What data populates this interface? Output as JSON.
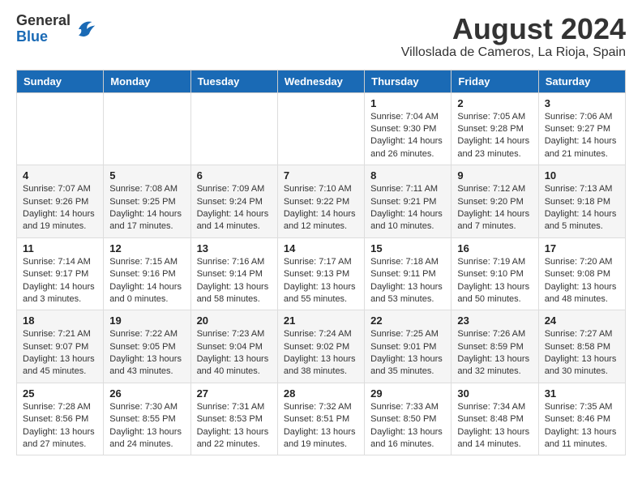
{
  "header": {
    "logo": {
      "general": "General",
      "blue": "Blue"
    },
    "title": "August 2024",
    "location": "Villoslada de Cameros, La Rioja, Spain"
  },
  "weekdays": [
    "Sunday",
    "Monday",
    "Tuesday",
    "Wednesday",
    "Thursday",
    "Friday",
    "Saturday"
  ],
  "weeks": [
    [
      {
        "day": "",
        "info": ""
      },
      {
        "day": "",
        "info": ""
      },
      {
        "day": "",
        "info": ""
      },
      {
        "day": "",
        "info": ""
      },
      {
        "day": "1",
        "info": "Sunrise: 7:04 AM\nSunset: 9:30 PM\nDaylight: 14 hours and 26 minutes."
      },
      {
        "day": "2",
        "info": "Sunrise: 7:05 AM\nSunset: 9:28 PM\nDaylight: 14 hours and 23 minutes."
      },
      {
        "day": "3",
        "info": "Sunrise: 7:06 AM\nSunset: 9:27 PM\nDaylight: 14 hours and 21 minutes."
      }
    ],
    [
      {
        "day": "4",
        "info": "Sunrise: 7:07 AM\nSunset: 9:26 PM\nDaylight: 14 hours and 19 minutes."
      },
      {
        "day": "5",
        "info": "Sunrise: 7:08 AM\nSunset: 9:25 PM\nDaylight: 14 hours and 17 minutes."
      },
      {
        "day": "6",
        "info": "Sunrise: 7:09 AM\nSunset: 9:24 PM\nDaylight: 14 hours and 14 minutes."
      },
      {
        "day": "7",
        "info": "Sunrise: 7:10 AM\nSunset: 9:22 PM\nDaylight: 14 hours and 12 minutes."
      },
      {
        "day": "8",
        "info": "Sunrise: 7:11 AM\nSunset: 9:21 PM\nDaylight: 14 hours and 10 minutes."
      },
      {
        "day": "9",
        "info": "Sunrise: 7:12 AM\nSunset: 9:20 PM\nDaylight: 14 hours and 7 minutes."
      },
      {
        "day": "10",
        "info": "Sunrise: 7:13 AM\nSunset: 9:18 PM\nDaylight: 14 hours and 5 minutes."
      }
    ],
    [
      {
        "day": "11",
        "info": "Sunrise: 7:14 AM\nSunset: 9:17 PM\nDaylight: 14 hours and 3 minutes."
      },
      {
        "day": "12",
        "info": "Sunrise: 7:15 AM\nSunset: 9:16 PM\nDaylight: 14 hours and 0 minutes."
      },
      {
        "day": "13",
        "info": "Sunrise: 7:16 AM\nSunset: 9:14 PM\nDaylight: 13 hours and 58 minutes."
      },
      {
        "day": "14",
        "info": "Sunrise: 7:17 AM\nSunset: 9:13 PM\nDaylight: 13 hours and 55 minutes."
      },
      {
        "day": "15",
        "info": "Sunrise: 7:18 AM\nSunset: 9:11 PM\nDaylight: 13 hours and 53 minutes."
      },
      {
        "day": "16",
        "info": "Sunrise: 7:19 AM\nSunset: 9:10 PM\nDaylight: 13 hours and 50 minutes."
      },
      {
        "day": "17",
        "info": "Sunrise: 7:20 AM\nSunset: 9:08 PM\nDaylight: 13 hours and 48 minutes."
      }
    ],
    [
      {
        "day": "18",
        "info": "Sunrise: 7:21 AM\nSunset: 9:07 PM\nDaylight: 13 hours and 45 minutes."
      },
      {
        "day": "19",
        "info": "Sunrise: 7:22 AM\nSunset: 9:05 PM\nDaylight: 13 hours and 43 minutes."
      },
      {
        "day": "20",
        "info": "Sunrise: 7:23 AM\nSunset: 9:04 PM\nDaylight: 13 hours and 40 minutes."
      },
      {
        "day": "21",
        "info": "Sunrise: 7:24 AM\nSunset: 9:02 PM\nDaylight: 13 hours and 38 minutes."
      },
      {
        "day": "22",
        "info": "Sunrise: 7:25 AM\nSunset: 9:01 PM\nDaylight: 13 hours and 35 minutes."
      },
      {
        "day": "23",
        "info": "Sunrise: 7:26 AM\nSunset: 8:59 PM\nDaylight: 13 hours and 32 minutes."
      },
      {
        "day": "24",
        "info": "Sunrise: 7:27 AM\nSunset: 8:58 PM\nDaylight: 13 hours and 30 minutes."
      }
    ],
    [
      {
        "day": "25",
        "info": "Sunrise: 7:28 AM\nSunset: 8:56 PM\nDaylight: 13 hours and 27 minutes."
      },
      {
        "day": "26",
        "info": "Sunrise: 7:30 AM\nSunset: 8:55 PM\nDaylight: 13 hours and 24 minutes."
      },
      {
        "day": "27",
        "info": "Sunrise: 7:31 AM\nSunset: 8:53 PM\nDaylight: 13 hours and 22 minutes."
      },
      {
        "day": "28",
        "info": "Sunrise: 7:32 AM\nSunset: 8:51 PM\nDaylight: 13 hours and 19 minutes."
      },
      {
        "day": "29",
        "info": "Sunrise: 7:33 AM\nSunset: 8:50 PM\nDaylight: 13 hours and 16 minutes."
      },
      {
        "day": "30",
        "info": "Sunrise: 7:34 AM\nSunset: 8:48 PM\nDaylight: 13 hours and 14 minutes."
      },
      {
        "day": "31",
        "info": "Sunrise: 7:35 AM\nSunset: 8:46 PM\nDaylight: 13 hours and 11 minutes."
      }
    ]
  ]
}
